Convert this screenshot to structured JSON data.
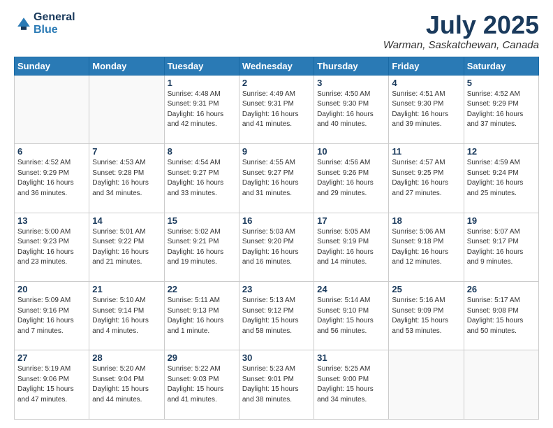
{
  "logo": {
    "general": "General",
    "blue": "Blue"
  },
  "header": {
    "title": "July 2025",
    "location": "Warman, Saskatchewan, Canada"
  },
  "days_of_week": [
    "Sunday",
    "Monday",
    "Tuesday",
    "Wednesday",
    "Thursday",
    "Friday",
    "Saturday"
  ],
  "weeks": [
    [
      {
        "day": "",
        "sunrise": "",
        "sunset": "",
        "daylight": ""
      },
      {
        "day": "",
        "sunrise": "",
        "sunset": "",
        "daylight": ""
      },
      {
        "day": "1",
        "sunrise": "Sunrise: 4:48 AM",
        "sunset": "Sunset: 9:31 PM",
        "daylight": "Daylight: 16 hours and 42 minutes."
      },
      {
        "day": "2",
        "sunrise": "Sunrise: 4:49 AM",
        "sunset": "Sunset: 9:31 PM",
        "daylight": "Daylight: 16 hours and 41 minutes."
      },
      {
        "day": "3",
        "sunrise": "Sunrise: 4:50 AM",
        "sunset": "Sunset: 9:30 PM",
        "daylight": "Daylight: 16 hours and 40 minutes."
      },
      {
        "day": "4",
        "sunrise": "Sunrise: 4:51 AM",
        "sunset": "Sunset: 9:30 PM",
        "daylight": "Daylight: 16 hours and 39 minutes."
      },
      {
        "day": "5",
        "sunrise": "Sunrise: 4:52 AM",
        "sunset": "Sunset: 9:29 PM",
        "daylight": "Daylight: 16 hours and 37 minutes."
      }
    ],
    [
      {
        "day": "6",
        "sunrise": "Sunrise: 4:52 AM",
        "sunset": "Sunset: 9:29 PM",
        "daylight": "Daylight: 16 hours and 36 minutes."
      },
      {
        "day": "7",
        "sunrise": "Sunrise: 4:53 AM",
        "sunset": "Sunset: 9:28 PM",
        "daylight": "Daylight: 16 hours and 34 minutes."
      },
      {
        "day": "8",
        "sunrise": "Sunrise: 4:54 AM",
        "sunset": "Sunset: 9:27 PM",
        "daylight": "Daylight: 16 hours and 33 minutes."
      },
      {
        "day": "9",
        "sunrise": "Sunrise: 4:55 AM",
        "sunset": "Sunset: 9:27 PM",
        "daylight": "Daylight: 16 hours and 31 minutes."
      },
      {
        "day": "10",
        "sunrise": "Sunrise: 4:56 AM",
        "sunset": "Sunset: 9:26 PM",
        "daylight": "Daylight: 16 hours and 29 minutes."
      },
      {
        "day": "11",
        "sunrise": "Sunrise: 4:57 AM",
        "sunset": "Sunset: 9:25 PM",
        "daylight": "Daylight: 16 hours and 27 minutes."
      },
      {
        "day": "12",
        "sunrise": "Sunrise: 4:59 AM",
        "sunset": "Sunset: 9:24 PM",
        "daylight": "Daylight: 16 hours and 25 minutes."
      }
    ],
    [
      {
        "day": "13",
        "sunrise": "Sunrise: 5:00 AM",
        "sunset": "Sunset: 9:23 PM",
        "daylight": "Daylight: 16 hours and 23 minutes."
      },
      {
        "day": "14",
        "sunrise": "Sunrise: 5:01 AM",
        "sunset": "Sunset: 9:22 PM",
        "daylight": "Daylight: 16 hours and 21 minutes."
      },
      {
        "day": "15",
        "sunrise": "Sunrise: 5:02 AM",
        "sunset": "Sunset: 9:21 PM",
        "daylight": "Daylight: 16 hours and 19 minutes."
      },
      {
        "day": "16",
        "sunrise": "Sunrise: 5:03 AM",
        "sunset": "Sunset: 9:20 PM",
        "daylight": "Daylight: 16 hours and 16 minutes."
      },
      {
        "day": "17",
        "sunrise": "Sunrise: 5:05 AM",
        "sunset": "Sunset: 9:19 PM",
        "daylight": "Daylight: 16 hours and 14 minutes."
      },
      {
        "day": "18",
        "sunrise": "Sunrise: 5:06 AM",
        "sunset": "Sunset: 9:18 PM",
        "daylight": "Daylight: 16 hours and 12 minutes."
      },
      {
        "day": "19",
        "sunrise": "Sunrise: 5:07 AM",
        "sunset": "Sunset: 9:17 PM",
        "daylight": "Daylight: 16 hours and 9 minutes."
      }
    ],
    [
      {
        "day": "20",
        "sunrise": "Sunrise: 5:09 AM",
        "sunset": "Sunset: 9:16 PM",
        "daylight": "Daylight: 16 hours and 7 minutes."
      },
      {
        "day": "21",
        "sunrise": "Sunrise: 5:10 AM",
        "sunset": "Sunset: 9:14 PM",
        "daylight": "Daylight: 16 hours and 4 minutes."
      },
      {
        "day": "22",
        "sunrise": "Sunrise: 5:11 AM",
        "sunset": "Sunset: 9:13 PM",
        "daylight": "Daylight: 16 hours and 1 minute."
      },
      {
        "day": "23",
        "sunrise": "Sunrise: 5:13 AM",
        "sunset": "Sunset: 9:12 PM",
        "daylight": "Daylight: 15 hours and 58 minutes."
      },
      {
        "day": "24",
        "sunrise": "Sunrise: 5:14 AM",
        "sunset": "Sunset: 9:10 PM",
        "daylight": "Daylight: 15 hours and 56 minutes."
      },
      {
        "day": "25",
        "sunrise": "Sunrise: 5:16 AM",
        "sunset": "Sunset: 9:09 PM",
        "daylight": "Daylight: 15 hours and 53 minutes."
      },
      {
        "day": "26",
        "sunrise": "Sunrise: 5:17 AM",
        "sunset": "Sunset: 9:08 PM",
        "daylight": "Daylight: 15 hours and 50 minutes."
      }
    ],
    [
      {
        "day": "27",
        "sunrise": "Sunrise: 5:19 AM",
        "sunset": "Sunset: 9:06 PM",
        "daylight": "Daylight: 15 hours and 47 minutes."
      },
      {
        "day": "28",
        "sunrise": "Sunrise: 5:20 AM",
        "sunset": "Sunset: 9:04 PM",
        "daylight": "Daylight: 15 hours and 44 minutes."
      },
      {
        "day": "29",
        "sunrise": "Sunrise: 5:22 AM",
        "sunset": "Sunset: 9:03 PM",
        "daylight": "Daylight: 15 hours and 41 minutes."
      },
      {
        "day": "30",
        "sunrise": "Sunrise: 5:23 AM",
        "sunset": "Sunset: 9:01 PM",
        "daylight": "Daylight: 15 hours and 38 minutes."
      },
      {
        "day": "31",
        "sunrise": "Sunrise: 5:25 AM",
        "sunset": "Sunset: 9:00 PM",
        "daylight": "Daylight: 15 hours and 34 minutes."
      },
      {
        "day": "",
        "sunrise": "",
        "sunset": "",
        "daylight": ""
      },
      {
        "day": "",
        "sunrise": "",
        "sunset": "",
        "daylight": ""
      }
    ]
  ]
}
